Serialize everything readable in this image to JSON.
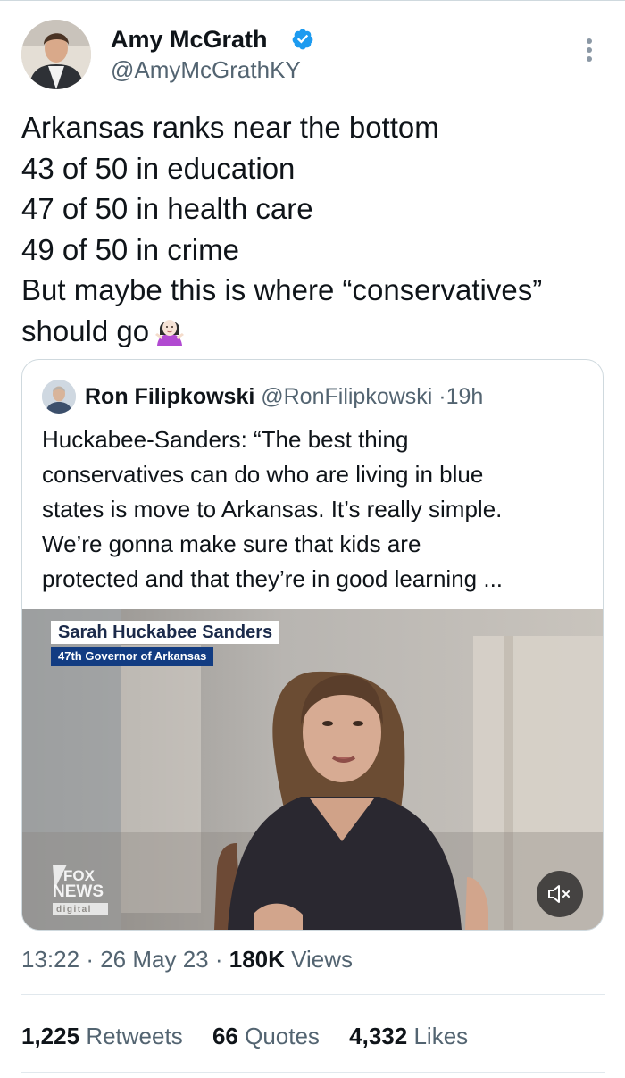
{
  "author": {
    "name": "Amy McGrath",
    "handle": "@AmyMcGrathKY",
    "verified_color": "#1d9bf0"
  },
  "tweet": {
    "lines": [
      "Arkansas ranks near the bottom",
      "43 of 50 in education",
      "47 of 50 in health care",
      "49 of 50 in crime",
      "But maybe this is where “conservatives”",
      "should go"
    ],
    "emoji": "woman-shrugging-icon"
  },
  "quoted_tweet": {
    "name": "Ron Filipkowski",
    "handle": "@RonFilipkowski",
    "separator": "·",
    "time": "19h",
    "lines": [
      "Huckabee-Sanders: “The best thing",
      "conservatives can do who are living in blue",
      "states is move to Arkansas. It’s really simple.",
      "We’re gonna make sure that kids are",
      "protected and that they’re in good learning ..."
    ],
    "media": {
      "lower_third_name": "Sarah Huckabee Sanders",
      "lower_third_title": "47th Governor of Arkansas",
      "network_logo_text": [
        "FOX",
        "NEWS",
        "digital"
      ],
      "mute_icon": "speaker-muted-icon"
    }
  },
  "meta": {
    "time": "13:22",
    "separator": "·",
    "date": "26 May 23",
    "views_count": "180K",
    "views_label": "Views"
  },
  "stats": {
    "retweets_count": "1,225",
    "retweets_label": "Retweets",
    "quotes_count": "66",
    "quotes_label": "Quotes",
    "likes_count": "4,332",
    "likes_label": "Likes"
  },
  "colors": {
    "text_primary": "#0f1419",
    "text_secondary": "#536471",
    "border": "#cfd9de",
    "fox_blue": "#123c82"
  }
}
